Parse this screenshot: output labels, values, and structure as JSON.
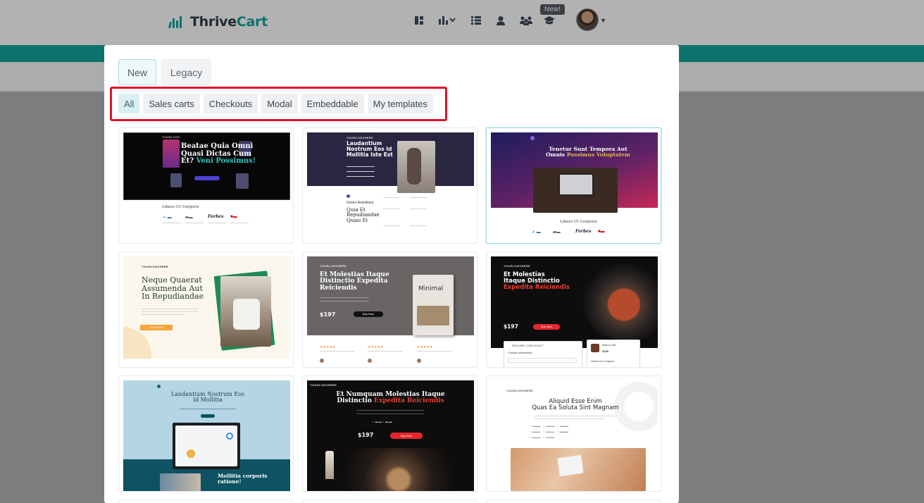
{
  "app": {
    "brand_prefix": "Thrive",
    "brand_suffix": "Cart",
    "new_badge": "New!"
  },
  "colors": {
    "teal": "#10a59b",
    "highlight_red": "#e0102a",
    "tab_active_bg": "#eef9fb"
  },
  "nav_icons": [
    "dashboard-icon",
    "analytics-icon",
    "list-icon",
    "customer-icon",
    "affiliates-icon",
    "academy-icon",
    "avatar"
  ],
  "modal": {
    "version_tabs": [
      {
        "label": "New",
        "active": true
      },
      {
        "label": "Legacy",
        "active": false
      }
    ],
    "filters": [
      {
        "label": "All",
        "active": true
      },
      {
        "label": "Sales carts",
        "active": false
      },
      {
        "label": "Checkouts",
        "active": false
      },
      {
        "label": "Modal",
        "active": false
      },
      {
        "label": "Embeddable",
        "active": false
      },
      {
        "label": "My templates",
        "active": false
      }
    ],
    "templates": [
      {
        "headline_a": "Beatae Quia Omni",
        "headline_b": "Quasi Dictas Cum",
        "headline_c": "Et?",
        "headline_accent": "Veni Possimus!",
        "section": "Libero Ut Corporis",
        "logo_forbes": "Forbes",
        "tag": "YOURLOGO"
      },
      {
        "tag": "YOURLOGOHERE",
        "headline": "Laudantium Nostrum Eos Id Mollitia Iste Est",
        "sub_head_a": "Quia Et",
        "sub_head_b": "Repudiandae",
        "sub_head_c": "Quasi Et",
        "small_label": "Dolore Asimiliano"
      },
      {
        "headline_a": "Tenetur Sunt Tempora Aut",
        "headline_b": "Omnis",
        "headline_accent": "Possimus Voluptatem",
        "section": "Libero Ut Corporis",
        "logo_forbes": "Forbes"
      },
      {
        "tag": "YOURLOGOHERE",
        "headline_a": "Neque Quaerat",
        "headline_b": "Assumenda Aut",
        "headline_c": "In Repudiandae",
        "button": "JOIN NOW"
      },
      {
        "tag": "YOURLOGOHERE",
        "headline": "Et Molestias Itaque Distinctio Expedita Reiciendis",
        "price": "$197",
        "button": "Buy Now",
        "book_title": "Minimal"
      },
      {
        "tag": "YOURLOGOHERE",
        "headline_a": "Et Molestias",
        "headline_b": "Itaque Distinctio",
        "headline_accent": "Expedita Reiciendis",
        "price": "$197",
        "button": "Buy Now",
        "checkout": "SECURE CHECKOUT",
        "contact": "Contact Information",
        "product": "Brand Cart",
        "product_price": "$195",
        "section": "Libero Ut Corporis"
      },
      {
        "headline_a": "Laudantium Nostrum Eos",
        "headline_b": "Id Mollitia",
        "subheadline_a": "Mollitia corporis",
        "subheadline_b": "ratione!"
      },
      {
        "tag": "YOURLOGOHERE",
        "headline_a": "Et Numquam Molestias Itaque",
        "headline_b": "Distinctio",
        "headline_accent": "Expedita Reiciendis",
        "price": "$197",
        "button": "Buy Now"
      },
      {
        "tag": "YOURLOGOHERE",
        "headline_a": "Aliquid Esse Enim",
        "headline_b": "Quas Ea Soluta Sint Magnam"
      }
    ]
  }
}
